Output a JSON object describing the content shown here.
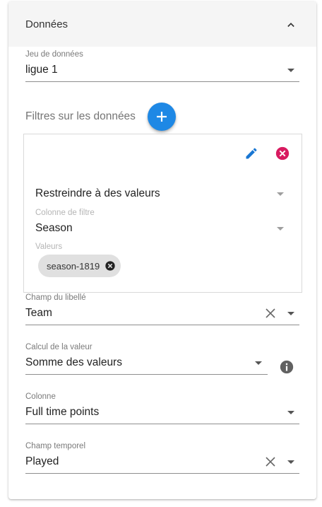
{
  "panel": {
    "title": "Données"
  },
  "dataset": {
    "label": "Jeu de données",
    "value": "ligue 1"
  },
  "filters": {
    "section_title": "Filtres sur les données",
    "filter_type": "Restreindre à des valeurs",
    "column": {
      "label": "Colonne de filtre",
      "value": "Season"
    },
    "values": {
      "label": "Valeurs",
      "chips": [
        "season-1819"
      ]
    }
  },
  "label_field": {
    "label": "Champ du libellé",
    "value": "Team"
  },
  "value_calc": {
    "label": "Calcul de la valeur",
    "value": "Somme des valeurs"
  },
  "column_field": {
    "label": "Colonne",
    "value": "Full time points"
  },
  "time_field": {
    "label": "Champ temporel",
    "value": "Played"
  },
  "colors": {
    "accent": "#1e88e5",
    "edit_icon": "#1976d2",
    "delete_icon": "#d81b60",
    "header_bg": "#f5f5f5"
  },
  "icons": {
    "collapse": "chevron-up-icon",
    "add": "plus-icon",
    "edit": "pencil-icon",
    "delete": "close-circle-icon",
    "info": "info-icon"
  }
}
